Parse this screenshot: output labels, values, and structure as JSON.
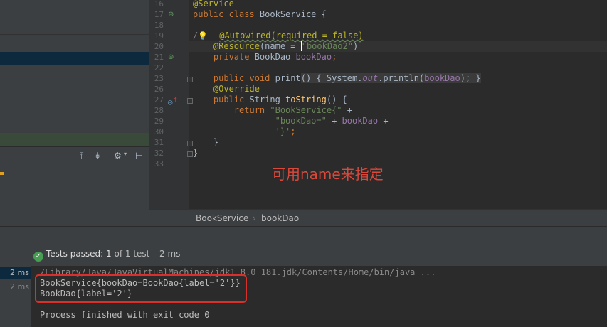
{
  "editor": {
    "lines": [
      {
        "num": "16"
      },
      {
        "num": "17"
      },
      {
        "num": "18"
      },
      {
        "num": "19"
      },
      {
        "num": "20"
      },
      {
        "num": "21"
      },
      {
        "num": "22"
      },
      {
        "num": "23"
      },
      {
        "num": "26"
      },
      {
        "num": "27"
      },
      {
        "num": "28"
      },
      {
        "num": "29"
      },
      {
        "num": "30"
      },
      {
        "num": "31"
      },
      {
        "num": "32"
      },
      {
        "num": "33"
      }
    ],
    "code": {
      "l16": "@Service",
      "l17_kw": "public class ",
      "l17_name": "BookService {",
      "l19_pre": "/",
      "l19_ann": "@Autowired(required = false)",
      "l20_ann": "@Resource",
      "l20_mid": "(name = ",
      "l20_str": "\"bookDao2\"",
      "l20_end": ")",
      "l21_kw": "private ",
      "l21_type": "BookDao ",
      "l21_fld": "bookDao",
      "l21_end": ";",
      "l23_kw": "public void ",
      "l23_fn": "print",
      "l23_a": "() { System.",
      "l23_out": "out",
      "l23_b": ".println(",
      "l23_fld": "bookDao",
      "l23_c": "); }",
      "l26": "@Override",
      "l27_kw": "public ",
      "l27_type": "String ",
      "l27_fn": "toString",
      "l27_end": "() {",
      "l28_kw": "return ",
      "l28_str": "\"BookService{\"",
      "l28_end": " +",
      "l29_str": "\"bookDao=\"",
      "l29_mid": " + ",
      "l29_fld": "bookDao",
      "l29_end": " +",
      "l30_str": "'}'",
      "l30_end": ";",
      "l31": "}",
      "l32": "}"
    }
  },
  "annotation_note": "可用name来指定",
  "breadcrumb": {
    "class": "BookService",
    "separator": "›",
    "member": "bookDao"
  },
  "run": {
    "tests_passed_label": "Tests passed:",
    "tests_count": "1",
    "tests_of": "of 1 test",
    "tests_time": "– 2 ms",
    "durations": [
      "2 ms",
      "2 ms"
    ],
    "console": {
      "cmd": "/Library/Java/JavaVirtualMachines/jdk1.8.0_181.jdk/Contents/Home/bin/java ...",
      "out1": "BookService{bookDao=BookDao{label='2'}}",
      "out2": "BookDao{label='2'}",
      "exit": "Process finished with exit code 0"
    }
  },
  "icons": {
    "spring_bean_icon": "spring-bean-icon",
    "bulb_icon": "lightbulb-icon",
    "override_icon": "override-icon",
    "check_icon": "check-icon"
  },
  "colors": {
    "annotation_red": "#d9483b",
    "passed_green": "#499c54"
  }
}
